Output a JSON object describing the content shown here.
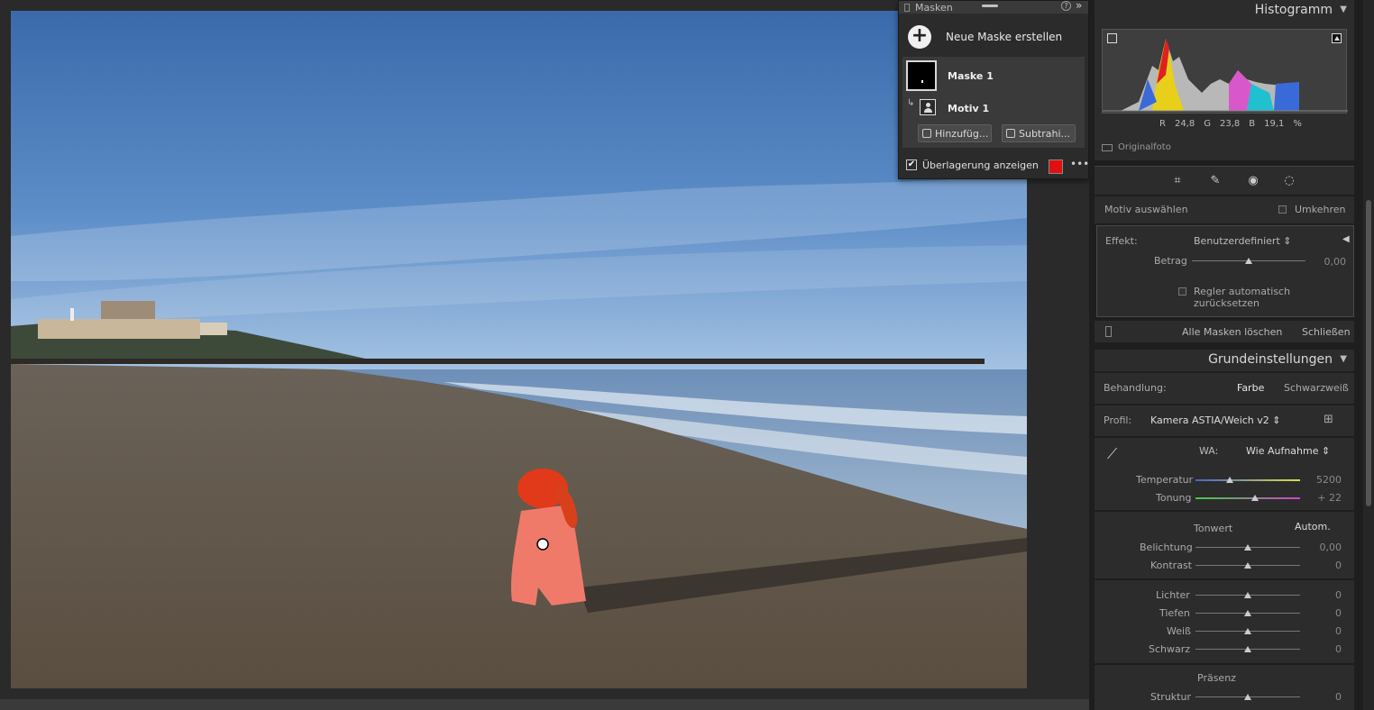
{
  "masks_panel": {
    "title": "Masken",
    "help": "?",
    "collapse": "»",
    "new_mask_icon": "+",
    "new_mask_label": "Neue Maske erstellen",
    "mask_name": "Maske 1",
    "submask_name": "Motiv 1",
    "add_button": "Hinzufüg...",
    "subtract_button": "Subtrahi...",
    "overlay_label": "Überlagerung anzeigen",
    "overlay_checked": "✔",
    "overlay_color": "#e01010",
    "more": "•••"
  },
  "histogram": {
    "title": "Histogramm",
    "r_label": "R",
    "r_value": "24,8",
    "g_label": "G",
    "g_value": "23,8",
    "b_label": "B",
    "b_value": "19,1",
    "unit": "%",
    "original_photo": "Originalfoto"
  },
  "tools": [
    "crop-icon",
    "healing-icon",
    "redeye-icon",
    "mask-icon"
  ],
  "mask_settings": {
    "select_subject": "Motiv auswählen",
    "invert": "Umkehren",
    "effect_label": "Effekt:",
    "effect_value": "Benutzerdefiniert ⇕",
    "amount_label": "Betrag",
    "amount_value": "0,00",
    "amount_level": 0.5,
    "auto_reset": "Regler automatisch zurücksetzen",
    "delete_all": "Alle Masken löschen",
    "close": "Schließen"
  },
  "basic": {
    "title": "Grundeinstellungen",
    "treatment_label": "Behandlung:",
    "treatment_color": "Farbe",
    "treatment_bw": "Schwarzweiß",
    "profile_label": "Profil:",
    "profile_value": "Kamera ASTIA/Weich v2 ⇕",
    "wb_label": "WA:",
    "wb_value": "Wie Aufnahme ⇕",
    "temp_label": "Temperatur",
    "temp_value": "5200",
    "tint_label": "Tonung",
    "tint_value": "+ 22",
    "tone_label": "Tonwert",
    "auto_label": "Autom.",
    "exposure_label": "Belichtung",
    "exposure_value": "0,00",
    "contrast_label": "Kontrast",
    "contrast_value": "0",
    "highlights_label": "Lichter",
    "highlights_value": "0",
    "shadows_label": "Tiefen",
    "shadows_value": "0",
    "whites_label": "Weiß",
    "whites_value": "0",
    "blacks_label": "Schwarz",
    "blacks_value": "0",
    "presence_label": "Präsenz",
    "texture_label": "Struktur",
    "texture_value": "0"
  }
}
